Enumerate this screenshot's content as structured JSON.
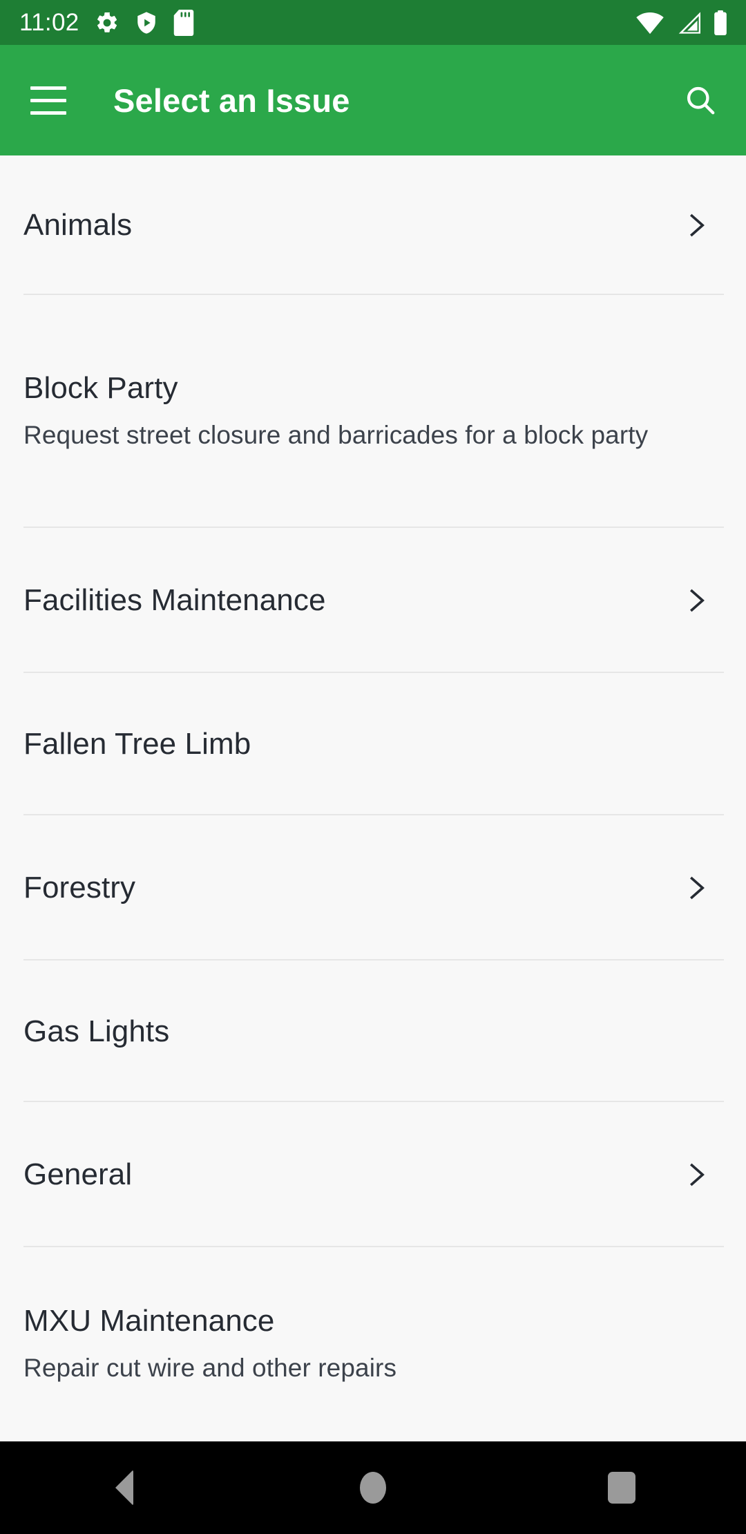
{
  "status_bar": {
    "time": "11:02",
    "left_icons": [
      "gear-icon",
      "shield-play-icon",
      "sd-card-icon"
    ],
    "right_icons": [
      "wifi-icon",
      "cellular-signal-icon",
      "battery-icon"
    ],
    "background_color": "#1E7E34",
    "foreground_color": "#FFFFFF"
  },
  "app_bar": {
    "title": "Select an Issue",
    "menu_icon": "hamburger-menu-icon",
    "search_icon": "search-icon",
    "background_color": "#2BA84A",
    "foreground_color": "#FFFFFF"
  },
  "list": {
    "background_color": "#F8F8F8",
    "divider_color": "#E6E6E6",
    "title_color": "#262B33",
    "subtitle_color": "#3C424B",
    "items": [
      {
        "title": "Animals",
        "subtitle": "",
        "chevron": true
      },
      {
        "title": "Block Party",
        "subtitle": "Request street closure and barricades for a block party",
        "chevron": false
      },
      {
        "title": "Facilities Maintenance",
        "subtitle": "",
        "chevron": true
      },
      {
        "title": "Fallen Tree Limb",
        "subtitle": "",
        "chevron": false
      },
      {
        "title": "Forestry",
        "subtitle": "",
        "chevron": true
      },
      {
        "title": "Gas Lights",
        "subtitle": "",
        "chevron": false
      },
      {
        "title": "General",
        "subtitle": "",
        "chevron": true
      },
      {
        "title": "MXU Maintenance",
        "subtitle": "Repair cut wire and other repairs",
        "chevron": false
      }
    ]
  },
  "nav_bar": {
    "background_color": "#000000",
    "glyph_color": "#9A9A9A",
    "buttons": [
      {
        "name": "back-button",
        "icon": "triangle-left-icon"
      },
      {
        "name": "home-button",
        "icon": "circle-icon"
      },
      {
        "name": "recents-button",
        "icon": "square-icon"
      }
    ]
  }
}
